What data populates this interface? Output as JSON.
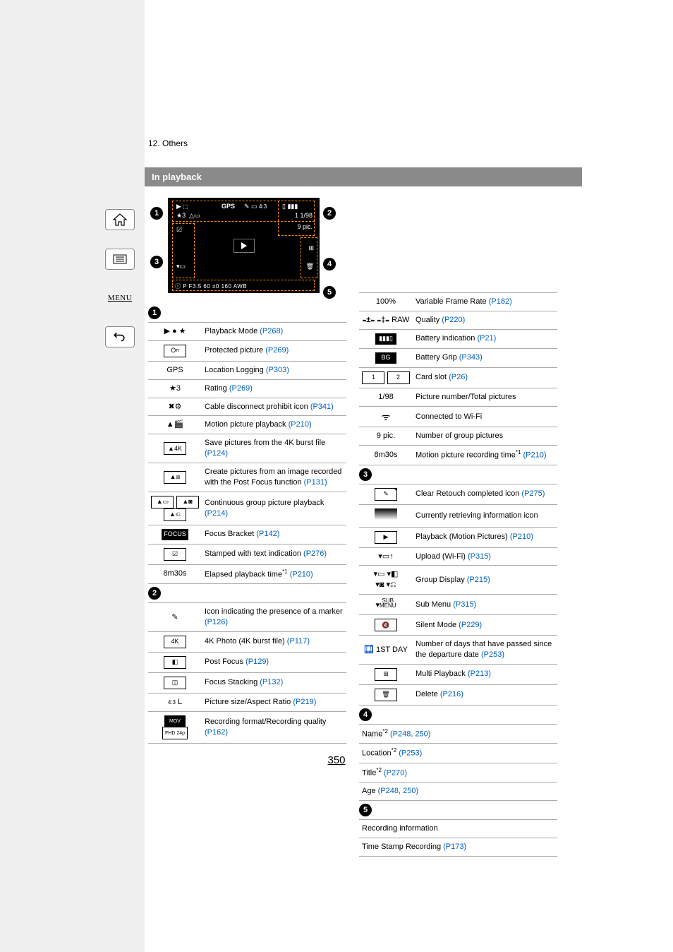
{
  "chapter": "12. Others",
  "section_header": "In playback",
  "page_number": "350",
  "sidebar": {
    "home": "⌂",
    "toc": "☰",
    "menu": "MENU",
    "back": "↶"
  },
  "diagram_overlay": {
    "gps": "GPS",
    "rating": "★3",
    "counter": "1 1/98",
    "group_count": "9 pic.",
    "info_bar": "P  F3.5  60   ±0   160   AWB"
  },
  "callouts": [
    "1",
    "2",
    "3",
    "4",
    "5"
  ],
  "group1": [
    {
      "icon": "▶ ● ★",
      "text": "Playback Mode ",
      "link": "(P268)"
    },
    {
      "icon_html": "<span class='icon-box outline'>O<span style='font-size:7px'>ח</span></span>",
      "text": "Protected picture ",
      "link": "(P269)"
    },
    {
      "icon": "GPS",
      "text": "Location Logging ",
      "link": "(P303)"
    },
    {
      "icon": "★3",
      "text": "Rating ",
      "link": "(P269)"
    },
    {
      "icon": "✖⚙",
      "text": "Cable disconnect prohibit icon ",
      "link": "(P341)"
    },
    {
      "icon": "▲🎬",
      "text": "Motion picture playback ",
      "link": "(P210)"
    },
    {
      "icon_html": "<span class='icon-box outline'>▲4K</span>",
      "text": "Save pictures from the 4K burst file ",
      "link": "(P124)"
    },
    {
      "icon_html": "<span class='icon-box outline'>▲⧈</span>",
      "text": "Create pictures from an image recorded with the Post Focus function ",
      "link": "(P131)"
    },
    {
      "icon_html": "<span class='icon-box outline'>▲▭</span> <span class='icon-box outline'>▲◙</span><br><span class='icon-box outline'>▲⎌</span>",
      "text": "Continuous group picture playback ",
      "link": "(P214)"
    },
    {
      "icon_html": "<span class='icon-box solid'>FOCUS</span>",
      "text": "Focus Bracket ",
      "link": "(P142)"
    },
    {
      "icon_html": "<span class='icon-box outline'>☑</span>",
      "text": "Stamped with text indication ",
      "link": "(P276)"
    },
    {
      "icon": "8m30s",
      "text_html": "Elapsed playback time<span class='sup'>*1</span> ",
      "link": "(P210)"
    }
  ],
  "group2_top": [
    {
      "icon": "✎",
      "text": "Icon indicating the presence of a marker ",
      "link": "(P126)"
    },
    {
      "icon_html": "<span class='icon-box outline'>4K</span>",
      "text": "4K Photo (4K burst file) ",
      "link": "(P117)"
    },
    {
      "icon_html": "<span class='icon-box outline'>◧</span>",
      "text": "Post Focus ",
      "link": "(P129)"
    },
    {
      "icon_html": "<span class='icon-box outline'>◫</span>",
      "text": "Focus Stacking ",
      "link": "(P132)"
    },
    {
      "icon_html": "<span style='font-size:8px'>4:3</span> L",
      "text": "Picture size/Aspect Ratio ",
      "link": "(P219)"
    },
    {
      "icon_html": "<span class='icon-box solid' style='font-size:7px'>MOV</span> <span class='icon-box outline' style='font-size:7px'>FHD 24p</span>",
      "text": "Recording format/Recording quality ",
      "link": "(P162)"
    }
  ],
  "group2_right": [
    {
      "icon": "100%",
      "text": "Variable Frame Rate ",
      "link": "(P182)"
    },
    {
      "icon_html": "<b>₌±₌  ₌‡₌</b>  RAW",
      "text": "Quality ",
      "link": "(P220)"
    },
    {
      "icon_html": "<span class='icon-box solid'>▮▮▮▯</span>",
      "text": "Battery indication ",
      "link": "(P21)"
    },
    {
      "icon_html": "<span class='icon-box solid'>BG</span>",
      "text": "Battery Grip ",
      "link": "(P343)"
    },
    {
      "icon_html": "<span class='icon-box outline'>1</span> <span class='icon-box outline'>2</span>",
      "text": "Card slot ",
      "link": "(P26)"
    },
    {
      "icon": "1/98",
      "text": "Picture number/Total pictures",
      "link": ""
    },
    {
      "icon_html": "<span style='font-size:14px'>ᯤ</span>",
      "text": "Connected to Wi-Fi",
      "link": ""
    },
    {
      "icon": "9 pic.",
      "text": "Number of group pictures",
      "link": ""
    },
    {
      "icon": "8m30s",
      "text_html": "Motion picture recording time<span class='sup'>*1</span> ",
      "link": "(P210)"
    }
  ],
  "group3": [
    {
      "icon_html": "<span class='icon-box outline' style='position:relative'>✎<span style=\"position:absolute;right:-2px;top:-2px;font-size:7px\">✦</span></span>",
      "text": "Clear Retouch completed icon ",
      "link": "(P275)"
    },
    {
      "icon_html": "<span class='icon-box' style='background:linear-gradient(#000,#fff);width:26px;'></span>",
      "text": "Currently retrieving information icon",
      "link": ""
    },
    {
      "icon_html": "<span class='icon-box outline'>▶</span>",
      "text": "Playback (Motion Pictures) ",
      "link": "(P210)"
    },
    {
      "icon_html": "▾▭<b>↑</b>",
      "text": "Upload (Wi-Fi) ",
      "link": "(P315)"
    },
    {
      "icon_html": "▾▭ ▾◧<br>▾◙ ▾⎌",
      "text": "Group Display ",
      "link": "(P215)"
    },
    {
      "icon_html": "▾<span style='font-size:8px;line-height:0.9;display:inline-block;text-align:center'>SUB<br>MENU</span>",
      "text": "Sub Menu ",
      "link": "(P315)"
    },
    {
      "icon_html": "<span class='icon-box outline'>🔇</span>",
      "text": "Silent Mode ",
      "link": "(P229)"
    },
    {
      "icon_html": "🛄 1ST DAY",
      "text": "Number of days that have passed since the departure date ",
      "link": "(P253)"
    },
    {
      "icon_html": "<span class='icon-box outline'>⊞</span>",
      "text": "Multi Playback ",
      "link": "(P213)"
    },
    {
      "icon_html": "<span class='icon-box outline'>🗑</span>",
      "text": "Delete ",
      "link": "(P216)"
    }
  ],
  "group4": [
    {
      "text_html": "Name<span class='sup'>*2</span> ",
      "links": "(P248, 250)",
      "link_parts": [
        "(P248",
        "250)"
      ]
    },
    {
      "text_html": "Location<span class='sup'>*2</span> ",
      "link": "(P253)"
    },
    {
      "text_html": "Title<span class='sup'>*2</span> ",
      "link": "(P270)"
    },
    {
      "text": "Age ",
      "links": "(P248, 250)"
    }
  ],
  "group5": [
    {
      "text": "Recording information"
    },
    {
      "text": "Time Stamp Recording ",
      "link": "(P173)"
    }
  ]
}
